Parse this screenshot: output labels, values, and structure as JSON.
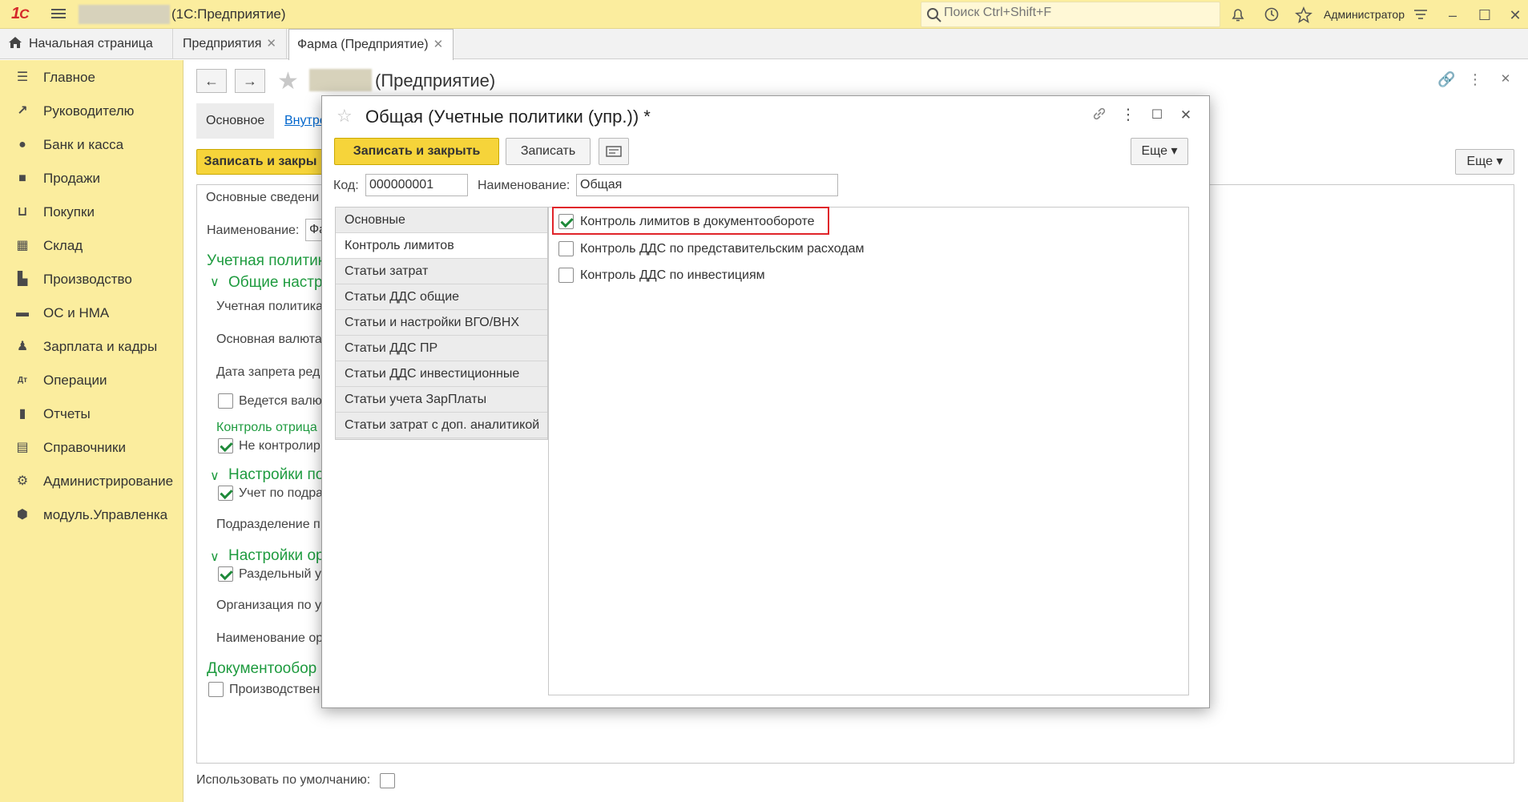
{
  "titlebar": {
    "app_title": "(1С:Предприятие)",
    "search_placeholder": "Поиск Ctrl+Shift+F",
    "user": "Администратор"
  },
  "tabs": [
    {
      "label": "Начальная страница",
      "closable": false
    },
    {
      "label": "Предприятия",
      "closable": true
    },
    {
      "label": "Фарма (Предприятие)",
      "closable": true,
      "active": true
    }
  ],
  "sidebar": {
    "items": [
      {
        "label": "Главное",
        "icon": "menu-lines-icon"
      },
      {
        "label": "Руководителю",
        "icon": "trend-icon"
      },
      {
        "label": "Банк и касса",
        "icon": "coin-icon"
      },
      {
        "label": "Продажи",
        "icon": "bag-icon"
      },
      {
        "label": "Покупки",
        "icon": "cart-icon"
      },
      {
        "label": "Склад",
        "icon": "warehouse-icon"
      },
      {
        "label": "Производство",
        "icon": "factory-icon"
      },
      {
        "label": "ОС и НМА",
        "icon": "truck-icon"
      },
      {
        "label": "Зарплата и кадры",
        "icon": "person-icon"
      },
      {
        "label": "Операции",
        "icon": "dt-kt-icon"
      },
      {
        "label": "Отчеты",
        "icon": "bar-chart-icon"
      },
      {
        "label": "Справочники",
        "icon": "book-icon"
      },
      {
        "label": "Администрирование",
        "icon": "gear-icon"
      },
      {
        "label": "модуль.Управленка",
        "icon": "cube-icon"
      }
    ]
  },
  "background_form": {
    "title": "(Предприятие)",
    "tab_main": "Основное",
    "tab_link": "Внутре",
    "save_close": "Записать и закры",
    "more": "Еще",
    "section_tab": "Основные сведени",
    "name_label": "Наименование:",
    "name_value": "Фа",
    "accounting_policies": "Учетная политик",
    "general_settings": "Общие настр",
    "policy_label": "Учетная политика",
    "currency_label": "Основная валюта",
    "lock_date_label": "Дата запрета ред",
    "maintained_label": "Ведется валю",
    "negative_control": "Контроль отрица",
    "not_controlled": "Не контролир",
    "settings_by": "Настройки по",
    "dept_accounting": "Учет по подра",
    "dept_label": "Подразделение п",
    "org_settings": "Настройки ор",
    "separate": "Раздельный у",
    "org_by": "Организация по у",
    "org_name": "Наименование ор",
    "docflow": "Документообор",
    "production": "Производствен",
    "use_default": "Использовать по умолчанию:"
  },
  "modal": {
    "title": "Общая (Учетные политики (упр.)) *",
    "save_close": "Записать и закрыть",
    "save": "Записать",
    "more": "Еще",
    "code_label": "Код:",
    "code_value": "000000001",
    "name_label": "Наименование:",
    "name_value": "Общая",
    "nav_items": [
      "Основные",
      "Контроль лимитов",
      "Статьи затрат",
      "Статьи ДДС общие",
      "Статьи и настройки ВГО/ВНХ",
      "Статьи ДДС ПР",
      "Статьи ДДС инвестиционные",
      "Статьи учета ЗарПлаты",
      "Статьи затрат с доп. аналитикой"
    ],
    "active_nav_index": 1,
    "options": [
      {
        "label": "Контроль лимитов в документообороте",
        "checked": true,
        "highlighted": true
      },
      {
        "label": "Контроль ДДС по представительским расходам",
        "checked": false
      },
      {
        "label": "Контроль ДДС по инвестициям",
        "checked": false
      }
    ]
  }
}
